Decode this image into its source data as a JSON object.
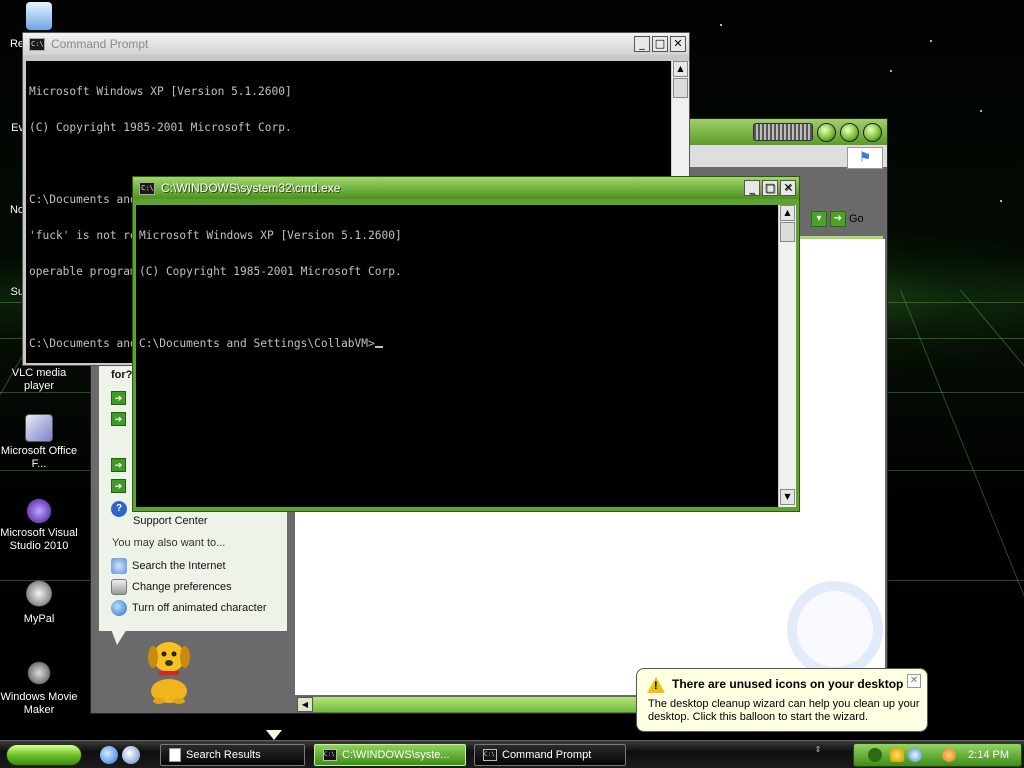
{
  "desktop": {
    "icons": [
      {
        "label": "VLC media player",
        "name": "vlc-media-player"
      },
      {
        "label": "Microsoft Office F...",
        "name": "microsoft-office-f"
      },
      {
        "label": "Microsoft Visual Studio 2010",
        "name": "microsoft-visual-studio-2010"
      },
      {
        "label": "MyPal",
        "name": "mypal"
      },
      {
        "label": "Windows Movie Maker",
        "name": "windows-movie-maker"
      }
    ],
    "partial_labels": [
      "Re",
      "Ev",
      "No",
      "Su"
    ]
  },
  "cmd_back": {
    "title": "Command Prompt",
    "lines": [
      "Microsoft Windows XP [Version 5.1.2600]",
      "(C) Copyright 1985-2001 Microsoft Corp.",
      "",
      "C:\\Documents and Settings\\CollabVM>fuck ur mom",
      "'fuck' is not recognized as an internal or external command,",
      "operable program or batch file.",
      "",
      "C:\\Documents and Settings\\CollabVM>"
    ]
  },
  "cmd_front": {
    "title": "C:\\WINDOWS\\system32\\cmd.exe",
    "lines": [
      "Microsoft Windows XP [Version 5.1.2600]",
      "(C) Copyright 1985-2001 Microsoft Corp.",
      "",
      "C:\\Documents and Settings\\CollabVM>"
    ]
  },
  "search_window": {
    "go_label": "Go",
    "sidebar_partial_heading": "for?",
    "support_center": "Support Center",
    "also_heading": "You may also want to...",
    "also_items": [
      "Search the Internet",
      "Change preferences",
      "Turn off animated character"
    ]
  },
  "balloon": {
    "title": "There are unused icons on your desktop",
    "body": "The desktop cleanup wizard can help you clean up your desktop. Click this balloon to start the wizard."
  },
  "taskbar": {
    "buttons": [
      {
        "label": "Search Results",
        "active": false
      },
      {
        "label": "C:\\WINDOWS\\syste...",
        "active": true
      },
      {
        "label": "Command Prompt",
        "active": false
      }
    ],
    "clock": "2:14 PM"
  },
  "colors": {
    "theme_green": "#5ea232",
    "console_bg": "#000000",
    "console_fg": "#c0c0c0",
    "balloon_bg": "#ffffe1"
  },
  "icons": [
    "recycle-bin-icon",
    "ie-icon",
    "explorer-icon",
    "warning-icon",
    "help-icon",
    "search-icon",
    "gear-icon",
    "globe-icon",
    "dog-character-icon"
  ]
}
